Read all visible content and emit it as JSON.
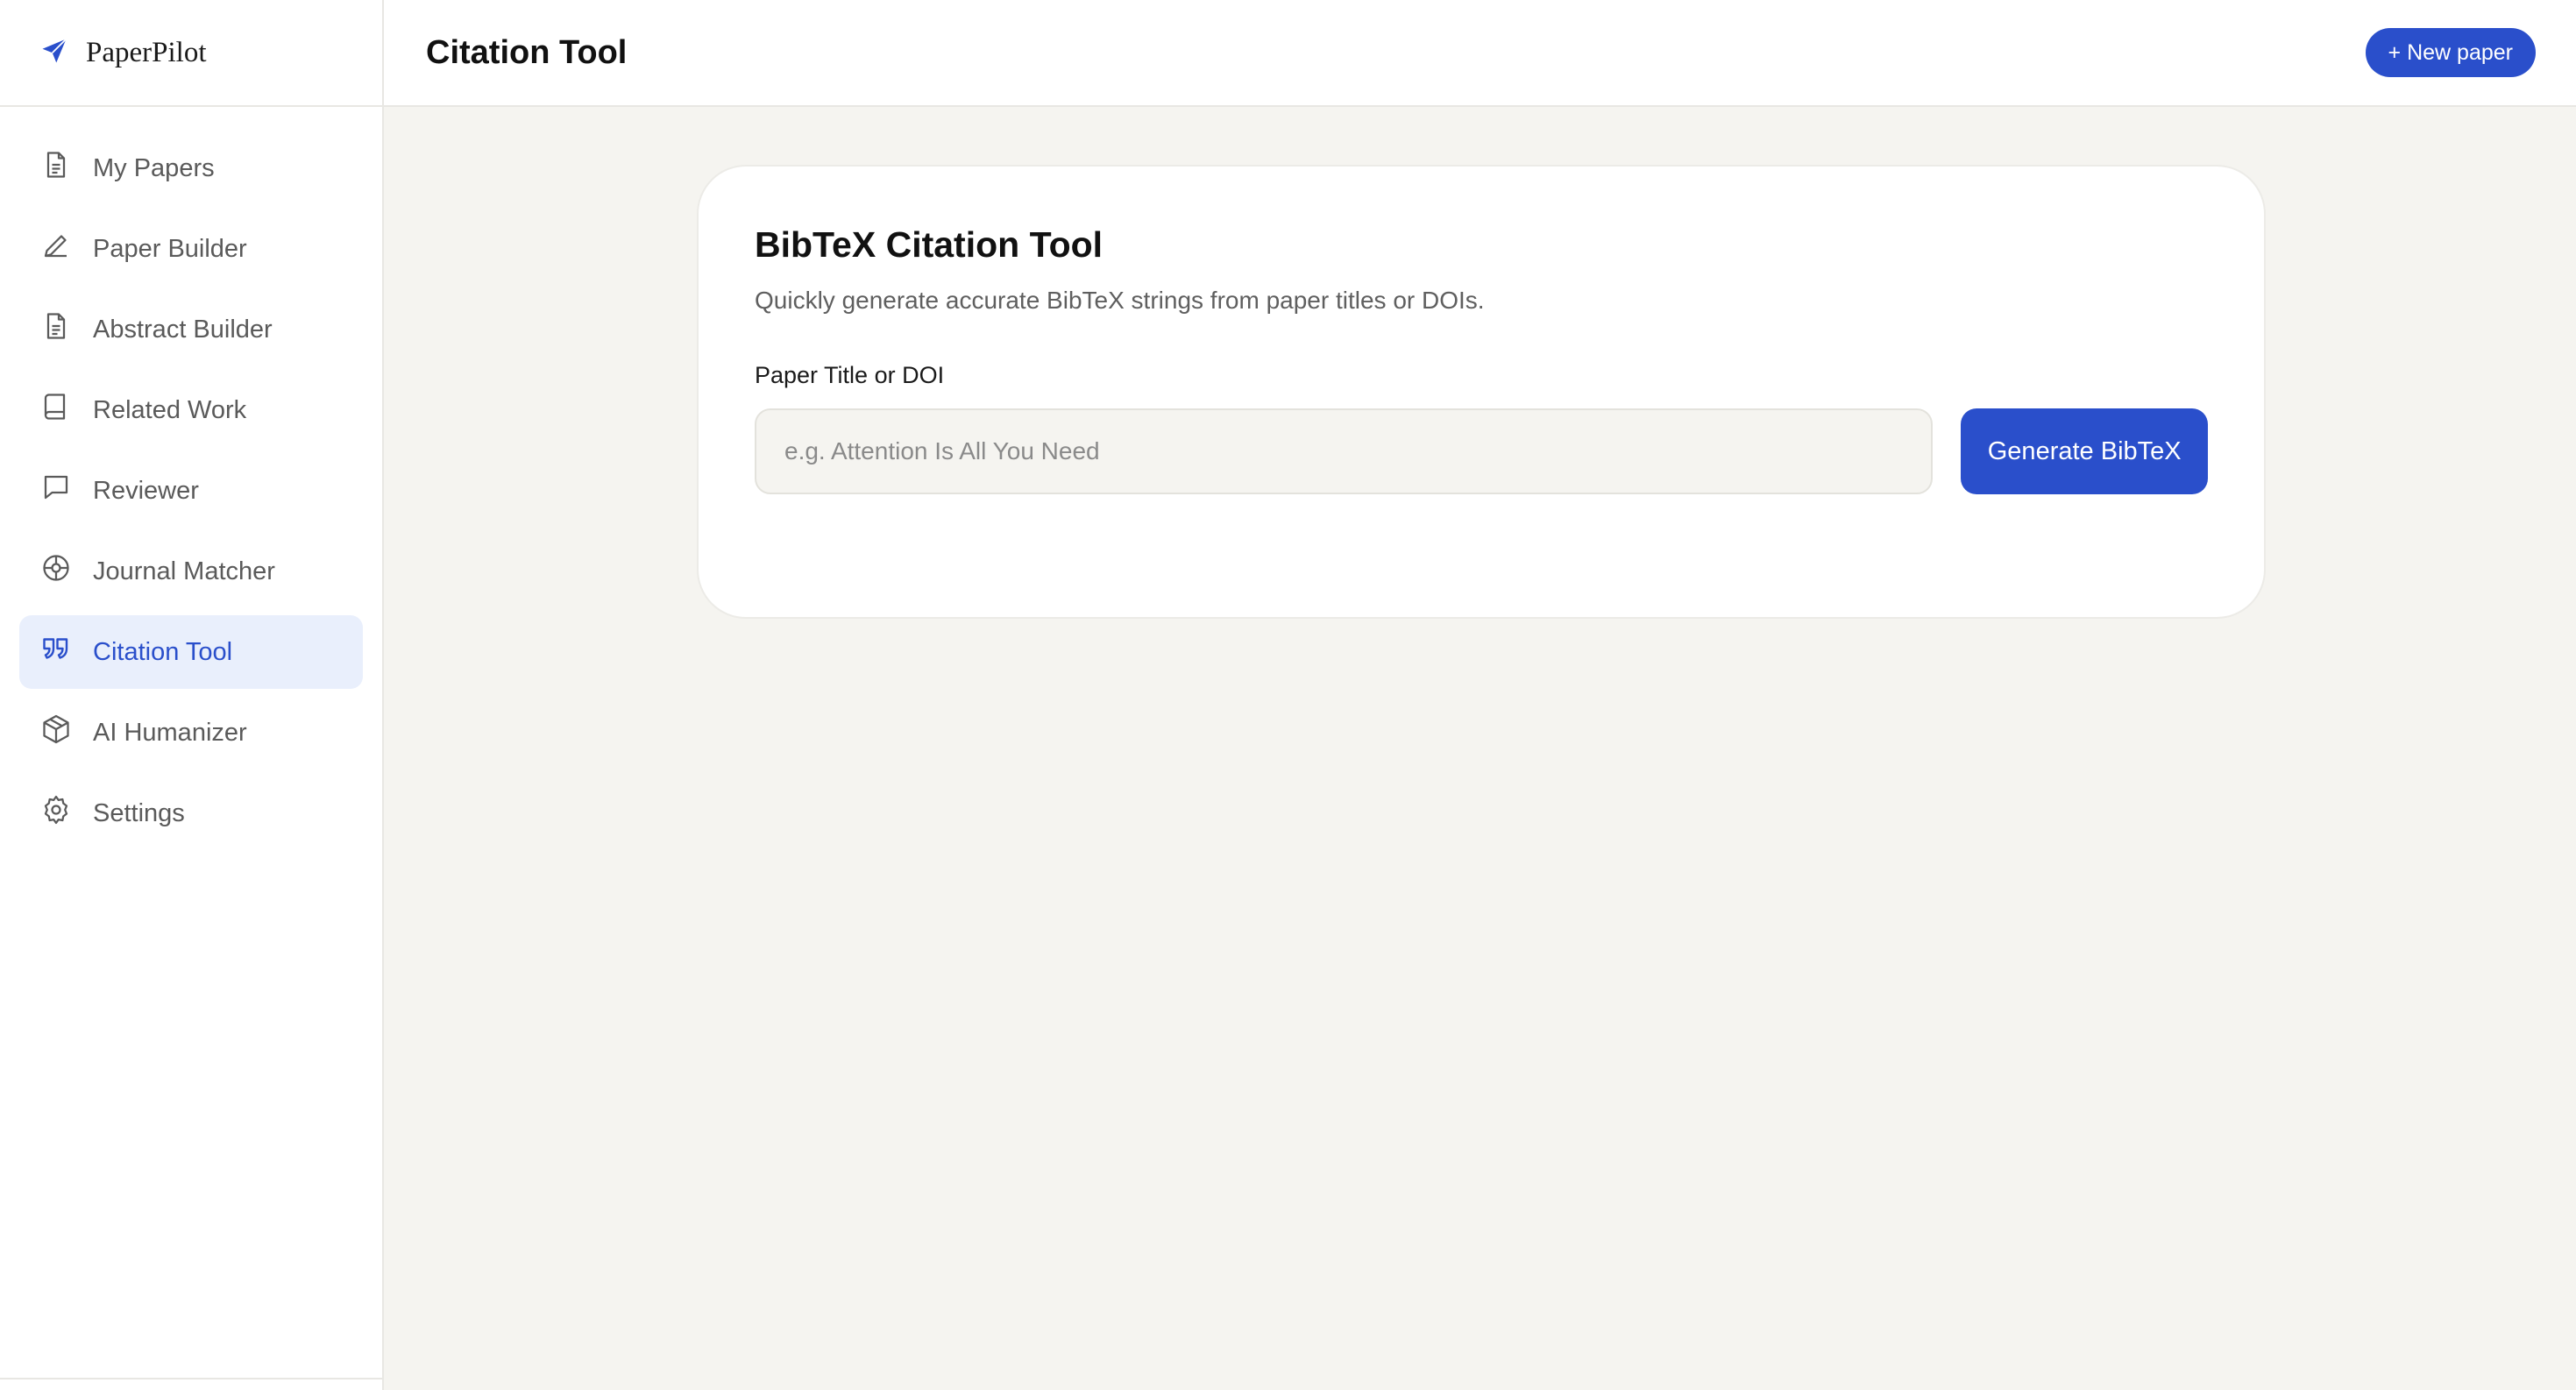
{
  "brand": {
    "name": "PaperPilot",
    "icon": "paper-plane-icon"
  },
  "sidebar": {
    "items": [
      {
        "label": "My Papers",
        "icon": "document-icon",
        "active": false
      },
      {
        "label": "Paper Builder",
        "icon": "pencil-icon",
        "active": false
      },
      {
        "label": "Abstract Builder",
        "icon": "document-icon",
        "active": false
      },
      {
        "label": "Related Work",
        "icon": "book-icon",
        "active": false
      },
      {
        "label": "Reviewer",
        "icon": "chat-bubble-icon",
        "active": false
      },
      {
        "label": "Journal Matcher",
        "icon": "target-icon",
        "active": false
      },
      {
        "label": "Citation Tool",
        "icon": "quote-icon",
        "active": true
      },
      {
        "label": "AI Humanizer",
        "icon": "cube-icon",
        "active": false
      },
      {
        "label": "Settings",
        "icon": "gear-icon",
        "active": false
      }
    ]
  },
  "header": {
    "title": "Citation Tool",
    "new_paper_label": "+ New paper"
  },
  "card": {
    "title": "BibTeX Citation Tool",
    "description": "Quickly generate accurate BibTeX strings from paper titles or DOIs.",
    "field_label": "Paper Title or DOI",
    "input_value": "",
    "input_placeholder": "e.g. Attention Is All You Need",
    "button_label": "Generate BibTeX"
  },
  "colors": {
    "accent": "#2a4fcb",
    "active_bg": "#e9effc",
    "page_bg": "#f5f4f0"
  }
}
